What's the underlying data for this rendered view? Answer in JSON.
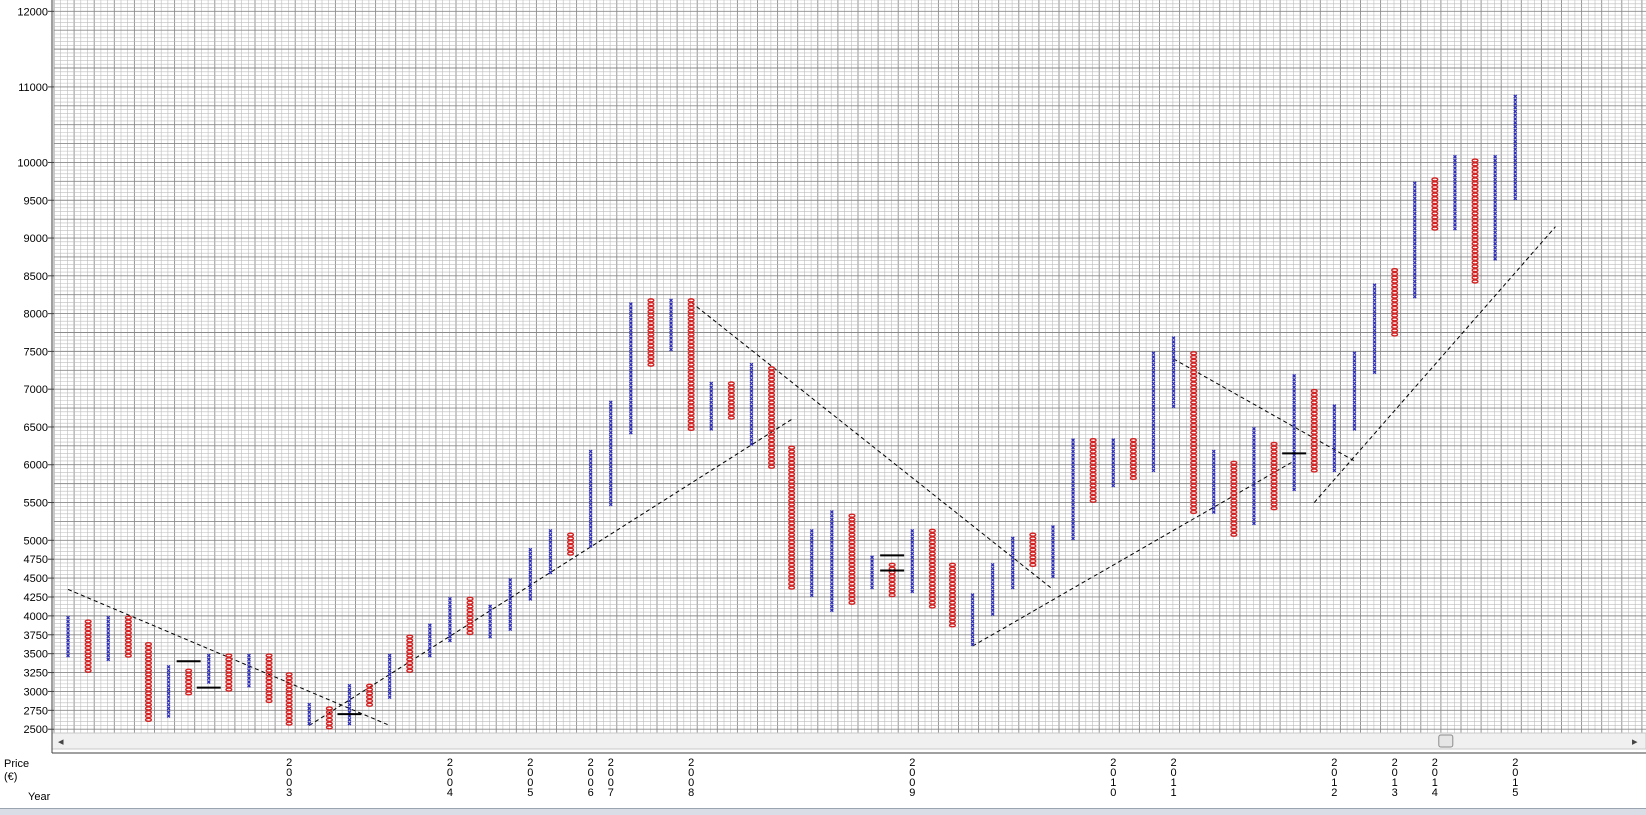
{
  "chart_data": {
    "type": "point-and-figure",
    "ylabel": "Price (€)",
    "xlabel": "Year",
    "ylim": [
      2450,
      12150
    ],
    "box_size": 50,
    "grid": true,
    "colors": {
      "x": "#2a2ab8",
      "o": "#d42020",
      "grid_minor": "#bdbdbd",
      "grid_major": "#8a8a8a",
      "trendline": "#000000"
    },
    "y_ticks": [
      2500,
      2750,
      3000,
      3250,
      3500,
      3750,
      4000,
      4250,
      4500,
      4750,
      5000,
      5500,
      6000,
      6500,
      7000,
      7500,
      8000,
      8500,
      9000,
      9500,
      10000,
      11000,
      12000
    ],
    "year_markers": [
      {
        "label": "2003",
        "column": 11
      },
      {
        "label": "2004",
        "column": 19
      },
      {
        "label": "2005",
        "column": 23
      },
      {
        "label": "2006",
        "column": 26
      },
      {
        "label": "2007",
        "column": 27
      },
      {
        "label": "2008",
        "column": 31
      },
      {
        "label": "2009",
        "column": 42
      },
      {
        "label": "2010",
        "column": 52
      },
      {
        "label": "2011",
        "column": 55
      },
      {
        "label": "2012",
        "column": 63
      },
      {
        "label": "2013",
        "column": 66
      },
      {
        "label": "2014",
        "column": 68
      },
      {
        "label": "2015",
        "column": 72
      }
    ],
    "columns": [
      {
        "type": "X",
        "low": 3450,
        "high": 3950
      },
      {
        "type": "O",
        "low": 3250,
        "high": 3900
      },
      {
        "type": "X",
        "low": 3400,
        "high": 3950
      },
      {
        "type": "O",
        "low": 3450,
        "high": 3950
      },
      {
        "type": "O",
        "low": 2600,
        "high": 3600
      },
      {
        "type": "X",
        "low": 2650,
        "high": 3300
      },
      {
        "type": "O",
        "low": 2950,
        "high": 3250
      },
      {
        "type": "X",
        "low": 3100,
        "high": 3450
      },
      {
        "type": "O",
        "low": 3000,
        "high": 3450
      },
      {
        "type": "X",
        "low": 3050,
        "high": 3450
      },
      {
        "type": "O",
        "low": 2850,
        "high": 3450
      },
      {
        "type": "O",
        "low": 2550,
        "high": 3200
      },
      {
        "type": "X",
        "low": 2550,
        "high": 2800
      },
      {
        "type": "O",
        "low": 2500,
        "high": 2750
      },
      {
        "type": "X",
        "low": 2550,
        "high": 3050
      },
      {
        "type": "O",
        "low": 2800,
        "high": 3050
      },
      {
        "type": "X",
        "low": 2900,
        "high": 3450
      },
      {
        "type": "O",
        "low": 3250,
        "high": 3700
      },
      {
        "type": "X",
        "low": 3450,
        "high": 3850
      },
      {
        "type": "X",
        "low": 3650,
        "high": 4200
      },
      {
        "type": "O",
        "low": 3750,
        "high": 4200
      },
      {
        "type": "X",
        "low": 3700,
        "high": 4100
      },
      {
        "type": "X",
        "low": 3800,
        "high": 4450
      },
      {
        "type": "X",
        "low": 4200,
        "high": 4850
      },
      {
        "type": "X",
        "low": 4550,
        "high": 5100
      },
      {
        "type": "O",
        "low": 4800,
        "high": 5050
      },
      {
        "type": "X",
        "low": 4900,
        "high": 6150
      },
      {
        "type": "X",
        "low": 5450,
        "high": 6800
      },
      {
        "type": "X",
        "low": 6400,
        "high": 8100
      },
      {
        "type": "O",
        "low": 7300,
        "high": 8150
      },
      {
        "type": "X",
        "low": 7500,
        "high": 8150
      },
      {
        "type": "O",
        "low": 6450,
        "high": 8150
      },
      {
        "type": "X",
        "low": 6450,
        "high": 7050
      },
      {
        "type": "O",
        "low": 6600,
        "high": 7050
      },
      {
        "type": "X",
        "low": 6250,
        "high": 7300
      },
      {
        "type": "O",
        "low": 5950,
        "high": 7250
      },
      {
        "type": "O",
        "low": 4350,
        "high": 6200
      },
      {
        "type": "X",
        "low": 4250,
        "high": 5100
      },
      {
        "type": "X",
        "low": 4050,
        "high": 5350
      },
      {
        "type": "O",
        "low": 4150,
        "high": 5300
      },
      {
        "type": "X",
        "low": 4350,
        "high": 4750
      },
      {
        "type": "O",
        "low": 4250,
        "high": 4650
      },
      {
        "type": "X",
        "low": 4300,
        "high": 5100
      },
      {
        "type": "O",
        "low": 4100,
        "high": 5100
      },
      {
        "type": "O",
        "low": 3850,
        "high": 4650
      },
      {
        "type": "X",
        "low": 3600,
        "high": 4250
      },
      {
        "type": "X",
        "low": 4000,
        "high": 4650
      },
      {
        "type": "X",
        "low": 4350,
        "high": 5000
      },
      {
        "type": "O",
        "low": 4650,
        "high": 5050
      },
      {
        "type": "X",
        "low": 4500,
        "high": 5150
      },
      {
        "type": "X",
        "low": 5000,
        "high": 6300
      },
      {
        "type": "O",
        "low": 5500,
        "high": 6300
      },
      {
        "type": "X",
        "low": 5700,
        "high": 6300
      },
      {
        "type": "O",
        "low": 5800,
        "high": 6300
      },
      {
        "type": "X",
        "low": 5900,
        "high": 7450
      },
      {
        "type": "X",
        "low": 6750,
        "high": 7650
      },
      {
        "type": "O",
        "low": 5350,
        "high": 7450
      },
      {
        "type": "X",
        "low": 5350,
        "high": 6150
      },
      {
        "type": "O",
        "low": 5050,
        "high": 6000
      },
      {
        "type": "X",
        "low": 5200,
        "high": 6450
      },
      {
        "type": "O",
        "low": 5400,
        "high": 6250
      },
      {
        "type": "X",
        "low": 5650,
        "high": 7150
      },
      {
        "type": "O",
        "low": 5900,
        "high": 6950
      },
      {
        "type": "X",
        "low": 5900,
        "high": 6750
      },
      {
        "type": "X",
        "low": 6450,
        "high": 7450
      },
      {
        "type": "X",
        "low": 7200,
        "high": 8350
      },
      {
        "type": "O",
        "low": 7700,
        "high": 8550
      },
      {
        "type": "X",
        "low": 8200,
        "high": 9700
      },
      {
        "type": "O",
        "low": 9100,
        "high": 9750
      },
      {
        "type": "X",
        "low": 9100,
        "high": 10050
      },
      {
        "type": "O",
        "low": 8400,
        "high": 10000
      },
      {
        "type": "X",
        "low": 8700,
        "high": 10050
      },
      {
        "type": "X",
        "low": 9500,
        "high": 10850
      }
    ],
    "trendlines": [
      {
        "style": "dashed",
        "points": [
          [
            0,
            4350
          ],
          [
            16,
            2550
          ]
        ]
      },
      {
        "style": "dashed",
        "points": [
          [
            12,
            2550
          ],
          [
            36,
            6600
          ]
        ]
      },
      {
        "style": "dashed",
        "points": [
          [
            31,
            8150
          ],
          [
            49,
            4350
          ]
        ]
      },
      {
        "style": "dashed",
        "points": [
          [
            45,
            3600
          ],
          [
            61,
            6050
          ]
        ]
      },
      {
        "style": "dashed",
        "points": [
          [
            55,
            7400
          ],
          [
            64,
            6050
          ]
        ]
      },
      {
        "style": "dashed",
        "points": [
          [
            62,
            5500
          ],
          [
            74,
            9150
          ]
        ]
      }
    ],
    "marker_bars": [
      {
        "column": 6,
        "value": 3400
      },
      {
        "column": 7,
        "value": 3050
      },
      {
        "column": 14,
        "value": 2700
      },
      {
        "column": 41,
        "value": 4800
      },
      {
        "column": 41,
        "value": 4600
      },
      {
        "column": 61,
        "value": 6150
      }
    ]
  },
  "labels": {
    "price_axis": "Price\n(€)",
    "year_axis": "Year"
  },
  "scrollbar": {
    "left_arrow": "◂",
    "right_arrow": "▸",
    "thumb_position": 0.88
  }
}
